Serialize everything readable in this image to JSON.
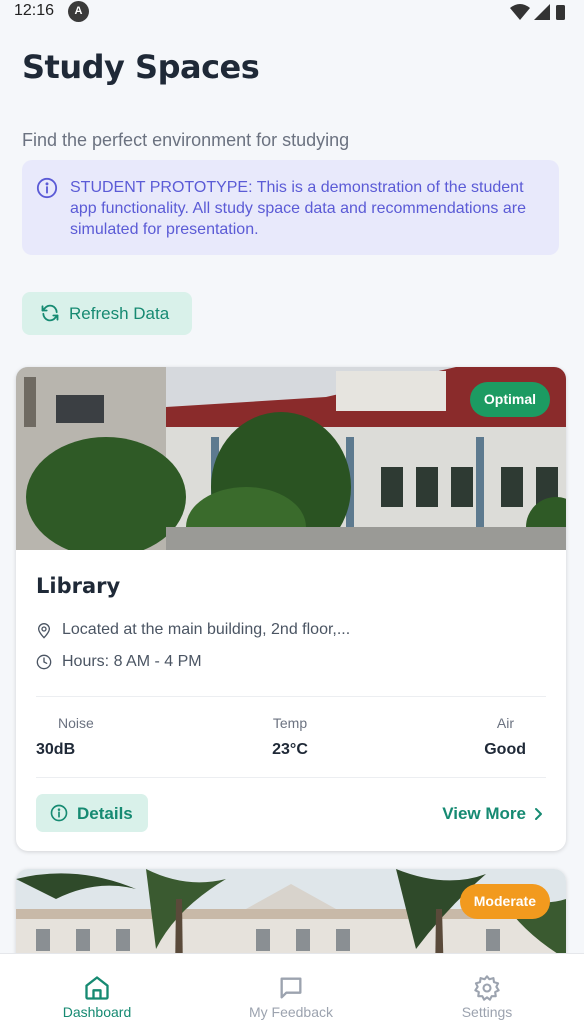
{
  "status_bar": {
    "time": "12:16",
    "notification_letter": "A"
  },
  "page": {
    "title": "Study Spaces",
    "subtitle": "Find the perfect environment for studying"
  },
  "notice": {
    "text": "STUDENT PROTOTYPE: This is a demonstration of the student app functionality. All study space data and recommendations are simulated for presentation.",
    "icon": "info-icon"
  },
  "refresh": {
    "label": "Refresh Data",
    "icon": "refresh-icon"
  },
  "spaces": [
    {
      "status": "Optimal",
      "name": "Library",
      "location": "Located at the main building, 2nd floor,...",
      "hours": "Hours: 8 AM - 4 PM",
      "metrics": [
        {
          "label": "Noise",
          "value": "30dB"
        },
        {
          "label": "Temp",
          "value": "23°C"
        },
        {
          "label": "Air",
          "value": "Good"
        }
      ],
      "details_label": "Details",
      "view_more_label": "View More"
    },
    {
      "status": "Moderate"
    }
  ],
  "bottom_nav": [
    {
      "label": "Dashboard",
      "icon": "home-icon",
      "active": true
    },
    {
      "label": "My Feedback",
      "icon": "message-icon",
      "active": false
    },
    {
      "label": "Settings",
      "icon": "gear-icon",
      "active": false
    }
  ],
  "colors": {
    "accent": "#168a72",
    "optimal": "#1c9b62",
    "moderate": "#f29a1e",
    "notice_bg": "#e8e9fb",
    "notice_text": "#5b5bd6"
  }
}
